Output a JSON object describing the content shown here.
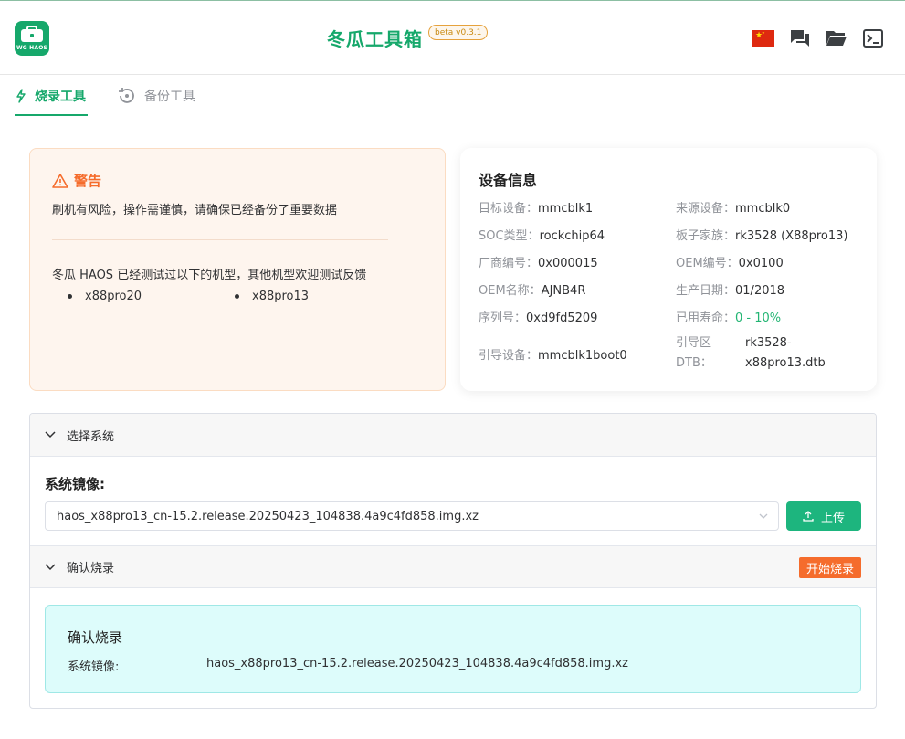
{
  "app": {
    "title": "冬瓜工具箱",
    "beta": "beta v0.3.1",
    "logo_text": "WG HAOS"
  },
  "header_icons": [
    "china-flag-icon",
    "chat-icon",
    "folder-open-icon",
    "terminal-icon"
  ],
  "tabs": [
    {
      "label": "烧录工具",
      "active": true,
      "icon": "lightning-icon"
    },
    {
      "label": "备份工具",
      "active": false,
      "icon": "backup-restore-icon"
    }
  ],
  "warning": {
    "title": "警告",
    "text": "刷机有风险，操作需谨慎，请确保已经备份了重要数据",
    "tested_text": "冬瓜 HAOS 已经测试过以下的机型，其他机型欢迎测试反馈",
    "models": [
      "x88pro20",
      "x88pro13"
    ]
  },
  "device_info": {
    "title": "设备信息",
    "rows": [
      {
        "key": "目标设备：",
        "value": "mmcblk1"
      },
      {
        "key": "来源设备：",
        "value": "mmcblk0"
      },
      {
        "key": "SOC类型：",
        "value": "rockchip64"
      },
      {
        "key": "板子家族：",
        "value": "rk3528 (X88pro13)"
      },
      {
        "key": "厂商编号：",
        "value": "0x000015"
      },
      {
        "key": "OEM编号：",
        "value": "0x0100"
      },
      {
        "key": "OEM名称：",
        "value": "AJNB4R"
      },
      {
        "key": "生产日期：",
        "value": "01/2018"
      },
      {
        "key": "序列号：",
        "value": "0xd9fd5209"
      },
      {
        "key": "已用寿命：",
        "value": "0 - 10%"
      },
      {
        "key": "引导设备：",
        "value": "mmcblk1boot0"
      }
    ],
    "boot_dtb_key": "引导区 DTB：",
    "boot_dtb_value": "rk3528-x88pro13.dtb"
  },
  "select_system": {
    "header": "选择系统",
    "image_label": "系统镜像:",
    "image_value": "haos_x88pro13_cn-15.2.release.20250423_104838.4a9c4fd858.img.xz",
    "upload_label": "上传"
  },
  "confirm": {
    "header": "确认烧录",
    "start_label": "开始烧录",
    "box_title": "确认烧录",
    "image_key": "系统镜像:",
    "image_value": "haos_x88pro13_cn-15.2.release.20250423_104838.4a9c4fd858.img.xz"
  },
  "colors": {
    "brand": "#16a86b",
    "warning": "#f56c2c",
    "success_text": "#22b573",
    "confirm_bg": "#ddfcfb"
  }
}
